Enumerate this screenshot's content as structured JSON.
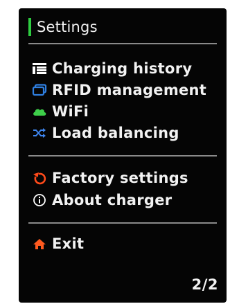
{
  "header": {
    "title": "Settings",
    "accent_color": "#2ecc40"
  },
  "menu": {
    "items": [
      {
        "label": "Charging history",
        "icon": "history-list-icon",
        "icon_color": "#ffffff"
      },
      {
        "label": "RFID management",
        "icon": "rfid-card-icon",
        "icon_color": "#2f7fe0"
      },
      {
        "label": "WiFi",
        "icon": "cloud-icon",
        "icon_color": "#3ecf4a"
      },
      {
        "label": "Load balancing",
        "icon": "shuffle-icon",
        "icon_color": "#3f86f0"
      },
      {
        "label": "Factory settings",
        "icon": "reset-icon",
        "icon_color": "#ff4a1a"
      },
      {
        "label": "About charger",
        "icon": "info-icon",
        "icon_color": "#ffffff"
      },
      {
        "label": "Exit",
        "icon": "home-icon",
        "icon_color": "#ff5a1f"
      }
    ]
  },
  "footer": {
    "page_indicator": "2/2"
  }
}
